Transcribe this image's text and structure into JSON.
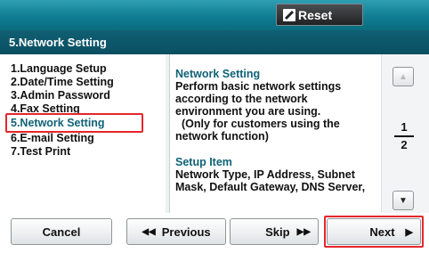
{
  "header": {
    "reset_label": "Reset"
  },
  "title": "5.Network Setting",
  "menu": {
    "items": [
      "1.Language Setup",
      "2.Date/Time Setting",
      "3.Admin Password",
      "4.Fax Setting",
      "5.Network Setting",
      "6.E-mail Setting",
      "7.Test Print"
    ],
    "selected_index": 4
  },
  "description": {
    "heading1": "Network Setting",
    "body1_lines": [
      "Perform basic network settings",
      "according to the network",
      "environment you are using.",
      "  (Only for customers using the",
      "network function)"
    ],
    "heading2": "Setup Item",
    "body2_lines": [
      "Network Type, IP Address, Subnet",
      "Mask, Default Gateway, DNS Server,"
    ]
  },
  "pager": {
    "current": "1",
    "total": "2"
  },
  "buttons": {
    "cancel": "Cancel",
    "previous": "Previous",
    "skip": "Skip",
    "next": "Next"
  },
  "colors": {
    "accent": "#0f6276",
    "highlight": "#e5262b",
    "header": "#107d92"
  }
}
